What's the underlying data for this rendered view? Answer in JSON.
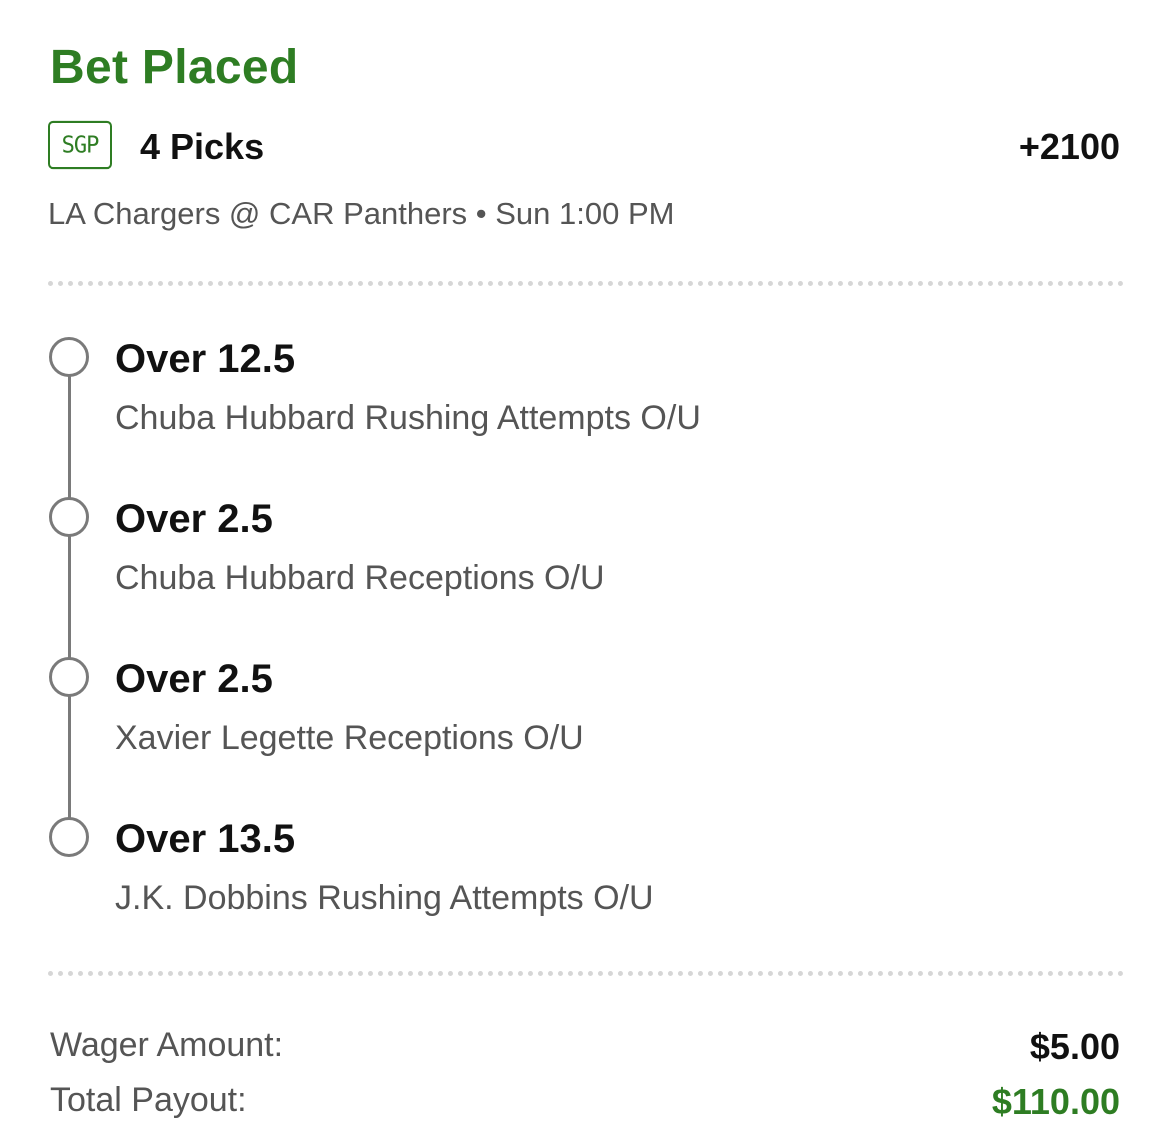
{
  "status": {
    "title": "Bet Placed",
    "color": "#2e7d23"
  },
  "bet": {
    "badge": "SGP",
    "picks_label": "4 Picks",
    "odds": "+2100",
    "game": "LA Chargers @ CAR Panthers • Sun 1:00 PM"
  },
  "legs": [
    {
      "selection": "Over 12.5",
      "market": "Chuba Hubbard Rushing Attempts O/U"
    },
    {
      "selection": "Over 2.5",
      "market": "Chuba Hubbard Receptions O/U"
    },
    {
      "selection": "Over 2.5",
      "market": "Xavier Legette Receptions O/U"
    },
    {
      "selection": "Over 13.5",
      "market": "J.K. Dobbins Rushing Attempts O/U"
    }
  ],
  "summary": {
    "wager_label": "Wager Amount:",
    "wager_value": "$5.00",
    "payout_label": "Total Payout:",
    "payout_value": "$110.00"
  },
  "icons": {
    "leg_status": "open-circle-icon",
    "badge": "sgp-badge-icon"
  }
}
